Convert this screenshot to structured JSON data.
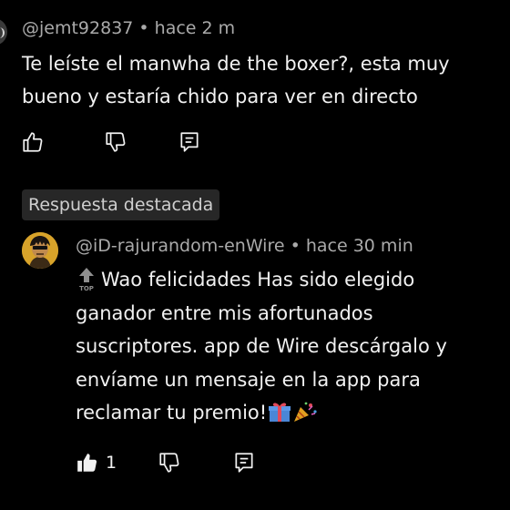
{
  "parent_comment": {
    "handle": "@jemt92837",
    "separator": " • ",
    "time": "hace 2 m",
    "text": "Te leíste el manwha de the boxer?, esta muy bueno y estaría chido para ver en directo",
    "icons": {
      "like": "thumbs-up-icon",
      "dislike": "thumbs-down-icon",
      "reply": "reply-icon"
    }
  },
  "highlighted_reply": {
    "label": "Respuesta destacada",
    "handle": "@iD-rajurandom-enWire",
    "separator": " • ",
    "time": "hace 30 min",
    "badge": "top-arrow-emoji",
    "text": "Wao felicidades Has sido elegido ganador entre mis afortunados suscriptores. app de Wire descárgalo y envíame un mensaje en la app para reclamar tu premio!",
    "trailing_emojis": [
      "gift-emoji",
      "party-popper-emoji"
    ],
    "like_count": "1",
    "icons": {
      "like": "thumbs-up-filled-icon",
      "dislike": "thumbs-down-icon",
      "reply": "reply-icon"
    }
  },
  "colors": {
    "background": "#000000",
    "primary_text": "#f1f1f1",
    "secondary_text": "#aaaaaa",
    "chip_background": "#272727",
    "avatar_accent": "#d8a32a"
  }
}
